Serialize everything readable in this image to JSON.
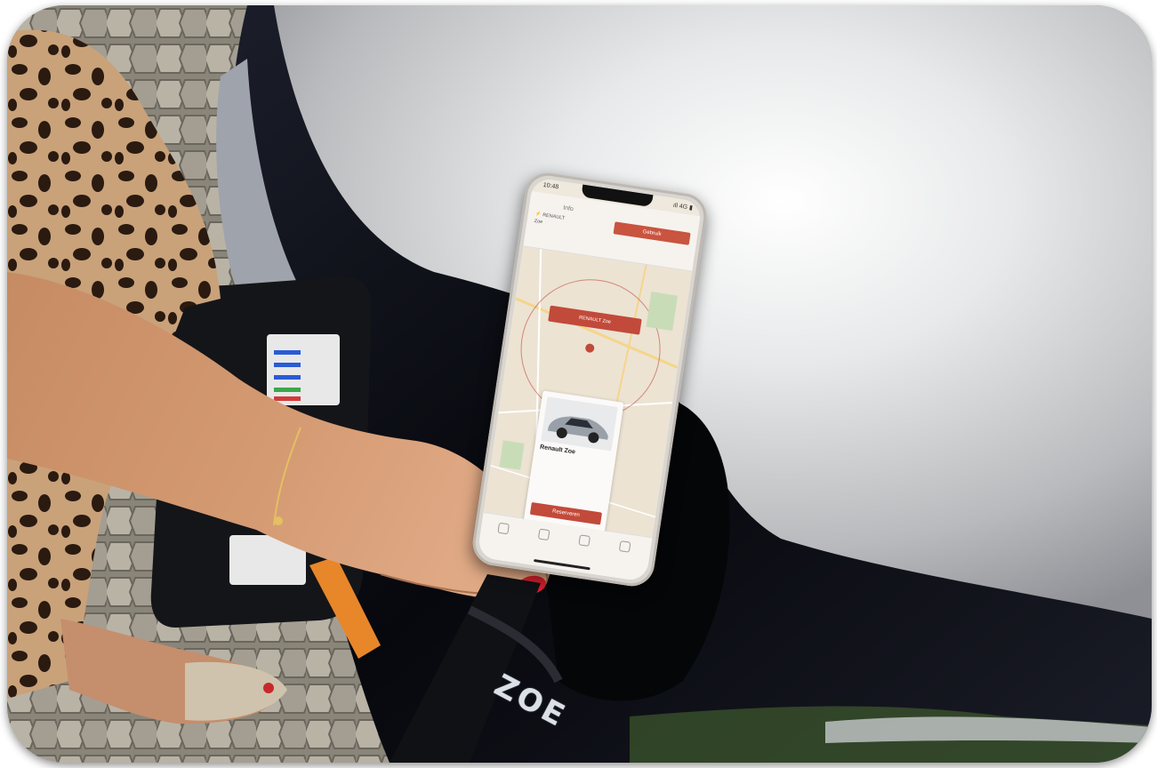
{
  "scene": {
    "car_badge": "ZOE"
  },
  "phone": {
    "status_time": "10:48",
    "status_right": "ıll 4G ▮",
    "header_tab": "Info",
    "header_button": "Gebruik",
    "info_lines": [
      "⚡ RENAULT",
      "Zoe"
    ],
    "map_banner": "RENAULT Zoe",
    "car_card": {
      "title": "Renault Zoe",
      "plate": "",
      "detail_1": "",
      "detail_2": "",
      "button": "Reserveren"
    },
    "nav": [
      {
        "label": ""
      },
      {
        "label": ""
      },
      {
        "label": ""
      },
      {
        "label": ""
      }
    ]
  },
  "colors": {
    "accent_red": "#c24a3a",
    "car_body": "#0d0f18",
    "hood_silver": "#c8c9cb"
  }
}
